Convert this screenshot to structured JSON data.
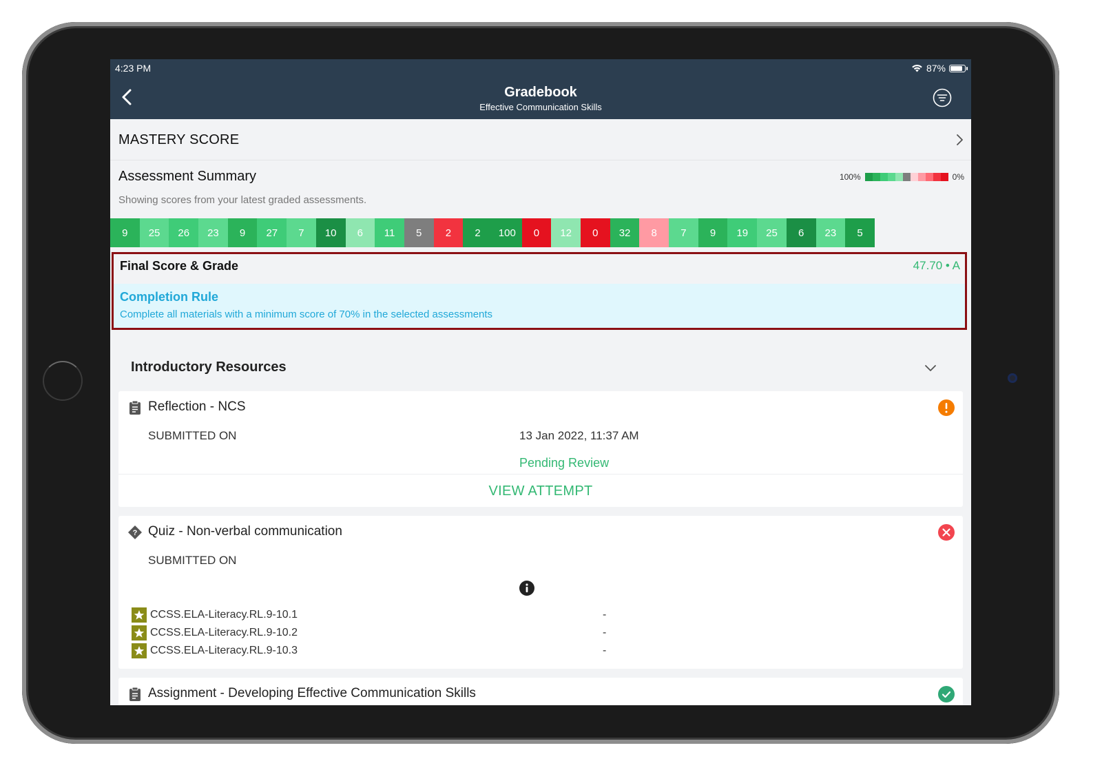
{
  "status_bar": {
    "time": "4:23 PM",
    "battery": "87%"
  },
  "nav": {
    "title": "Gradebook",
    "subtitle": "Effective Communication Skills"
  },
  "mastery": {
    "label": "MASTERY SCORE"
  },
  "summary": {
    "title": "Assessment Summary",
    "description": "Showing scores from your latest graded assessments.",
    "legend_high": "100%",
    "legend_low": "0%",
    "legend_colors": [
      "#1e9e4a",
      "#2bb35a",
      "#3fcc78",
      "#5cd98f",
      "#8fe6b0",
      "#7e7e7e",
      "#ffd1d6",
      "#ff9aa3",
      "#ff6b75",
      "#f2333f",
      "#e5121f"
    ]
  },
  "scores": [
    {
      "value": "9",
      "color": "#2bb35a"
    },
    {
      "value": "25",
      "color": "#5cd98f"
    },
    {
      "value": "26",
      "color": "#3fcc78"
    },
    {
      "value": "23",
      "color": "#5cd98f"
    },
    {
      "value": "9",
      "color": "#2bb35a"
    },
    {
      "value": "27",
      "color": "#3fcc78"
    },
    {
      "value": "7",
      "color": "#5cd98f"
    },
    {
      "value": "10",
      "color": "#1b8f45"
    },
    {
      "value": "6",
      "color": "#8fe6b0"
    },
    {
      "value": "11",
      "color": "#3fcc78"
    },
    {
      "value": "5",
      "color": "#7e7e7e"
    },
    {
      "value": "2",
      "color": "#f2333f"
    },
    {
      "value": "2",
      "color": "#1e9e4a"
    },
    {
      "value": "100",
      "color": "#1e9e4a"
    },
    {
      "value": "0",
      "color": "#e5121f"
    },
    {
      "value": "12",
      "color": "#8fe6b0"
    },
    {
      "value": "0",
      "color": "#e5121f"
    },
    {
      "value": "32",
      "color": "#2bb35a"
    },
    {
      "value": "8",
      "color": "#ff9aa3"
    },
    {
      "value": "7",
      "color": "#5cd98f"
    },
    {
      "value": "9",
      "color": "#2bb35a"
    },
    {
      "value": "19",
      "color": "#3fcc78"
    },
    {
      "value": "25",
      "color": "#5cd98f"
    },
    {
      "value": "6",
      "color": "#1b8f45"
    },
    {
      "value": "23",
      "color": "#5cd98f"
    },
    {
      "value": "5",
      "color": "#1e9e4a"
    }
  ],
  "final": {
    "label": "Final Score & Grade",
    "score": "47.70 • A",
    "rule_title": "Completion Rule",
    "rule_desc": "Complete all materials with a minimum score of 70% in the selected assessments"
  },
  "section": {
    "title": "Introductory Resources"
  },
  "cards": {
    "reflection": {
      "title": "Reflection - NCS",
      "submitted_label": "SUBMITTED ON",
      "submitted_value": "13 Jan 2022, 11:37 AM",
      "status": "Pending Review",
      "action": "VIEW ATTEMPT",
      "status_icon": "warning-icon"
    },
    "quiz": {
      "title": "Quiz - Non-verbal communication",
      "submitted_label": "SUBMITTED ON",
      "status_icon": "error-icon",
      "standards": [
        {
          "code": "CCSS.ELA-Literacy.RL.9-10.1",
          "value": "-"
        },
        {
          "code": "CCSS.ELA-Literacy.RL.9-10.2",
          "value": "-"
        },
        {
          "code": "CCSS.ELA-Literacy.RL.9-10.3",
          "value": "-"
        }
      ]
    },
    "assignment": {
      "title": "Assignment - Developing Effective Communication Skills",
      "status_icon": "check-icon"
    }
  },
  "colors": {
    "nav_bg": "#2c3e50",
    "accent_green": "#33b873",
    "accent_blue": "#21a8d8",
    "highlight_border": "#8b1014"
  }
}
